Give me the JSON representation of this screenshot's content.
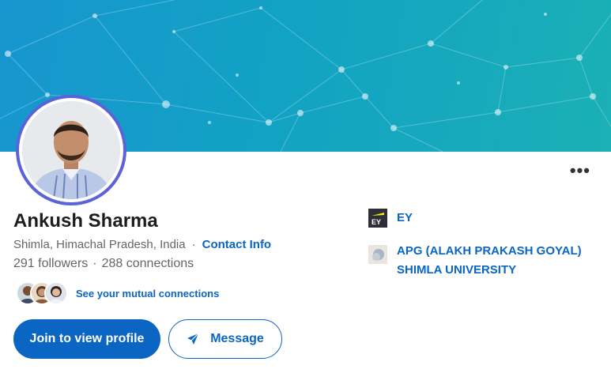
{
  "profile": {
    "name": "Ankush Sharma",
    "location": "Shimla, Himachal Pradesh, India",
    "separator": "·",
    "contact_label": "Contact Info",
    "followers": "291 followers",
    "connections": "288 connections"
  },
  "mutual": {
    "label": "See your mutual connections"
  },
  "actions": {
    "join_label": "Join to view profile",
    "message_label": "Message",
    "more_label": "•••"
  },
  "organizations": [
    {
      "name": "EY",
      "logo_text": "EY",
      "icon": "ey-logo-icon"
    },
    {
      "name": "APG (ALAKH PRAKASH GOYAL) SHIMLA UNIVERSITY",
      "icon": "school-logo-icon"
    }
  ],
  "colors": {
    "accent": "#0a66c2",
    "banner_start": "#1796cf",
    "banner_end": "#1ab0b6",
    "avatar_ring": "#5b64d6"
  }
}
